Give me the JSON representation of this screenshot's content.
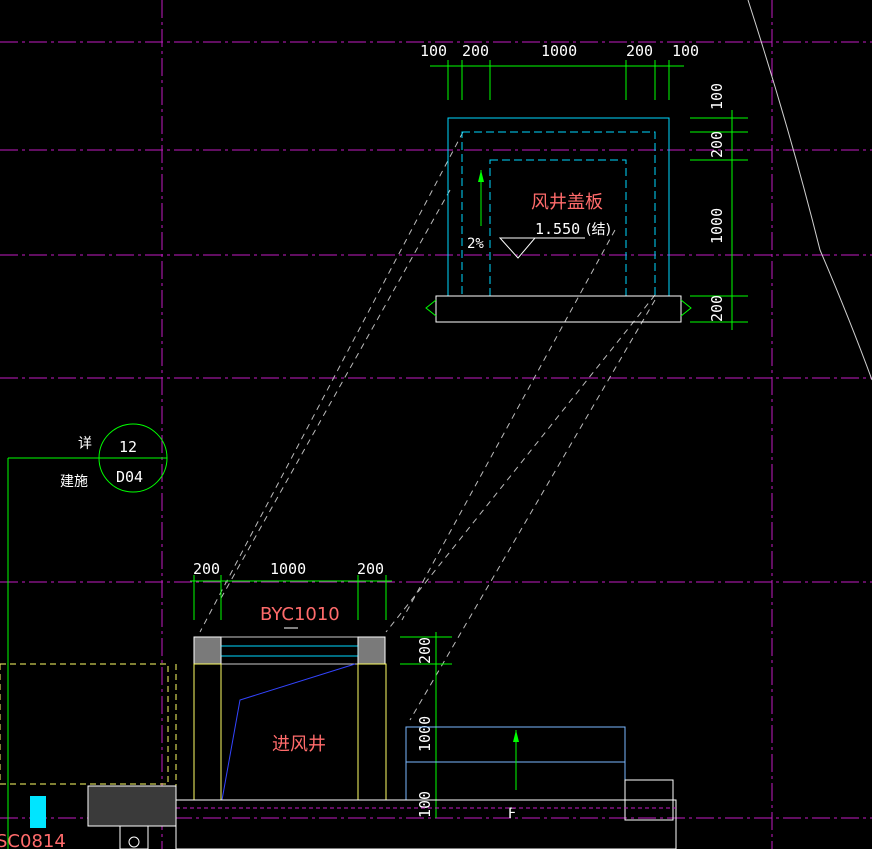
{
  "drawing": {
    "top_detail": {
      "dims_horizontal": [
        "100",
        "200",
        "1000",
        "200",
        "100"
      ],
      "dims_vertical": [
        "100",
        "200",
        "1000",
        "200"
      ],
      "cover_label": "风井盖板",
      "elevation": "1.550",
      "elevation_note": "(结)",
      "slope": "2%"
    },
    "callout": {
      "label_left": "详",
      "label_left2": "建施",
      "number": "12",
      "sheet": "D04"
    },
    "bottom_detail": {
      "dims_horizontal": [
        "200",
        "1000",
        "200"
      ],
      "window_tag": "BYC1010",
      "shaft_label": "进风井",
      "dims_vertical": [
        "200",
        "1000",
        "100"
      ],
      "partial_tag": "SC0814",
      "small_mark": "F"
    },
    "colors": {
      "grid_magenta": "#c21bc2",
      "dim_green": "#00ff00",
      "wall_cyan": "#00d8ff",
      "label_red": "#ff6b6b",
      "yellow": "#ffff66"
    }
  }
}
